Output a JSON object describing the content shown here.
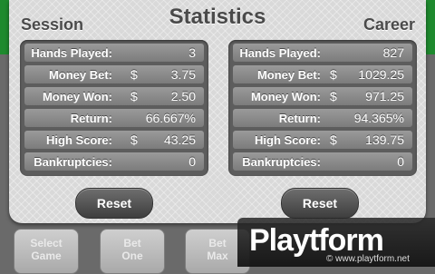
{
  "dialog": {
    "title": "Statistics",
    "session": {
      "heading": "Session",
      "rows": [
        {
          "label": "Hands Played:",
          "currency": "",
          "value": "3"
        },
        {
          "label": "Money Bet:",
          "currency": "$",
          "value": "3.75"
        },
        {
          "label": "Money Won:",
          "currency": "$",
          "value": "2.50"
        },
        {
          "label": "Return:",
          "currency": "",
          "value": "66.667%"
        },
        {
          "label": "High Score:",
          "currency": "$",
          "value": "43.25"
        },
        {
          "label": "Bankruptcies:",
          "currency": "",
          "value": "0"
        }
      ],
      "reset_label": "Reset"
    },
    "career": {
      "heading": "Career",
      "rows": [
        {
          "label": "Hands Played:",
          "currency": "",
          "value": "827"
        },
        {
          "label": "Money Bet:",
          "currency": "$",
          "value": "1029.25"
        },
        {
          "label": "Money Won:",
          "currency": "$",
          "value": "971.25"
        },
        {
          "label": "Return:",
          "currency": "",
          "value": "94.365%"
        },
        {
          "label": "High Score:",
          "currency": "$",
          "value": "139.75"
        },
        {
          "label": "Bankruptcies:",
          "currency": "",
          "value": "0"
        }
      ],
      "reset_label": "Reset"
    }
  },
  "background_buttons": [
    {
      "line1": "Select",
      "line2": "Game"
    },
    {
      "line1": "Bet",
      "line2": "One"
    },
    {
      "line1": "Bet",
      "line2": "Max"
    }
  ],
  "watermark": {
    "logo": "Playtform",
    "url": "© www.playtform.net"
  },
  "colors": {
    "felt": "#1e8a2e",
    "panel": "#5d5d5d",
    "reset_button": "#4a4a4a"
  }
}
